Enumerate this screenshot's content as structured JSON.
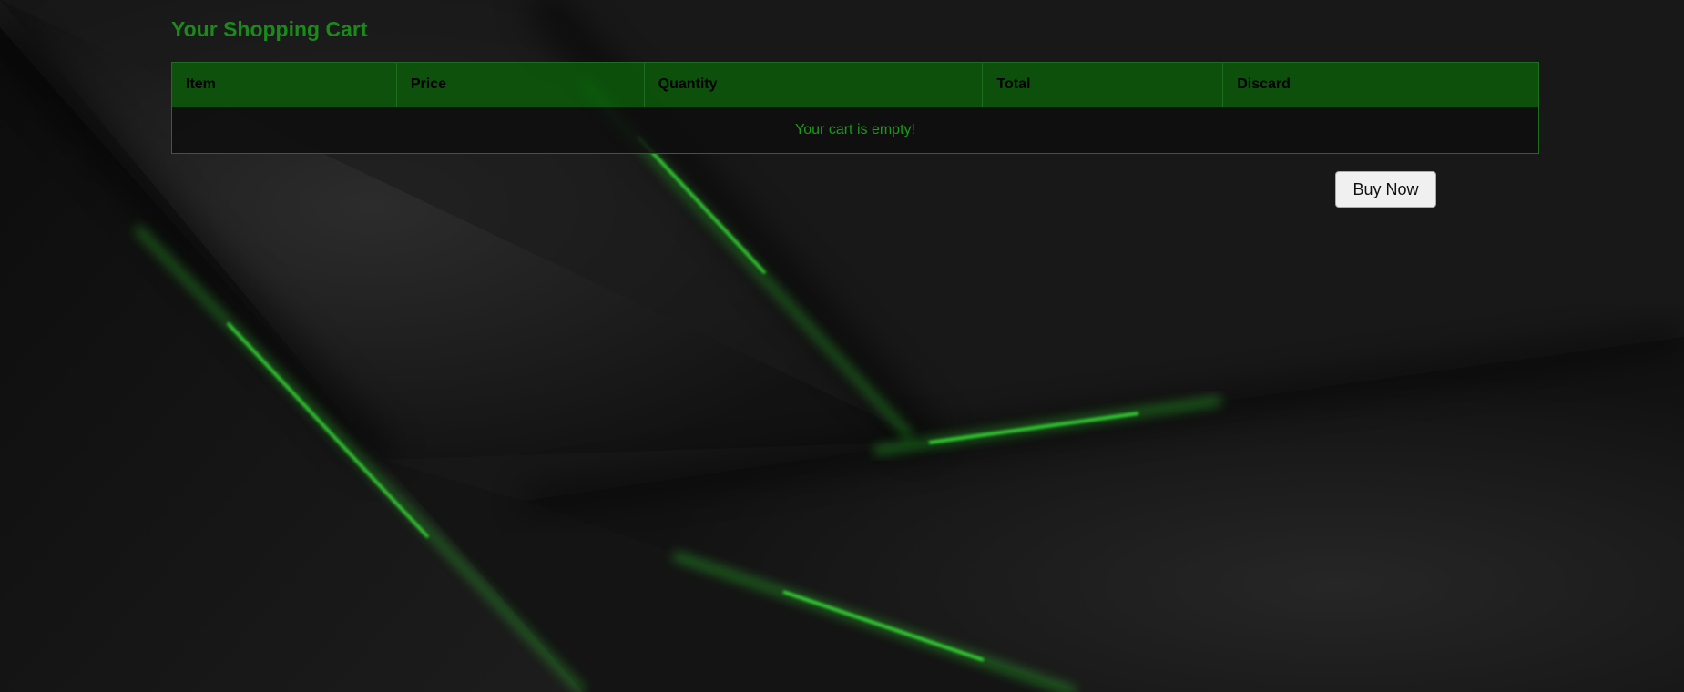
{
  "page": {
    "title": "Your Shopping Cart"
  },
  "cart_table": {
    "headers": {
      "item": "Item",
      "price": "Price",
      "quantity": "Quantity",
      "total": "Total",
      "discard": "Discard"
    },
    "empty_message": "Your cart is empty!"
  },
  "actions": {
    "buy_now_label": "Buy Now"
  },
  "colors": {
    "accent_green": "#1a8a1a",
    "header_bg": "#0a5a0a",
    "background": "#161616",
    "glow_green": "#3cff3c"
  }
}
